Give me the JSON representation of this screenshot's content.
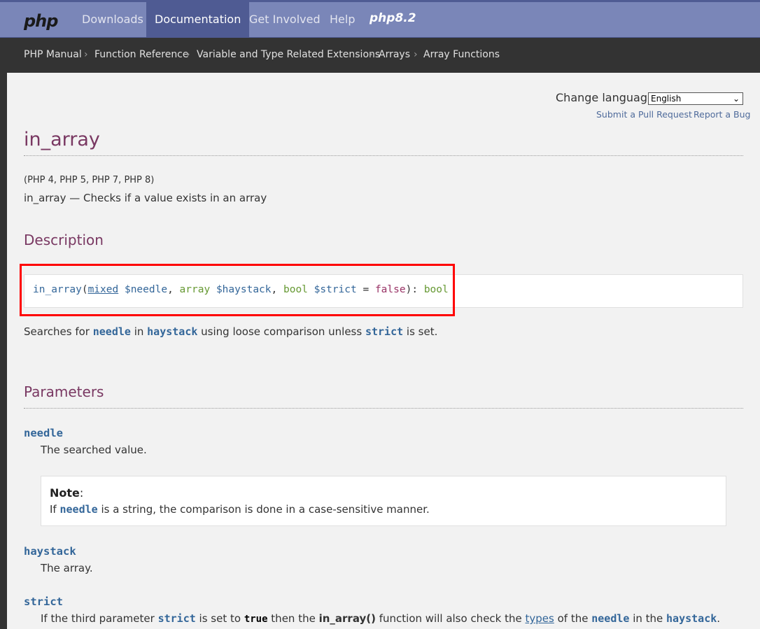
{
  "nav": {
    "logo": "php",
    "items": [
      "Downloads",
      "Documentation",
      "Get Involved",
      "Help"
    ],
    "release": "php8.2"
  },
  "breadcrumb": [
    "PHP Manual",
    "Function Reference",
    "Variable and Type Related Extensions",
    "Arrays",
    "Array Functions"
  ],
  "breadcrumb_sep": "›",
  "lang": {
    "label": "Change language:",
    "selected": "English",
    "submit_pr": "Submit a Pull Request",
    "report_bug": "Report a Bug"
  },
  "page": {
    "title": "in_array",
    "versions": "(PHP 4, PHP 5, PHP 7, PHP 8)",
    "refpurpose": "in_array — Checks if a value exists in an array"
  },
  "description": {
    "heading": "Description",
    "signature": {
      "fn": "in_array",
      "open": "(",
      "t1": "mixed",
      "v1": "$needle",
      "comma1": ", ",
      "t2": "array",
      "v2": "$haystack",
      "comma2": ", ",
      "t3": "bool",
      "v3": "$strict",
      "eq": " = ",
      "default": "false",
      "close": "): ",
      "ret": "bool"
    },
    "text": {
      "a": "Searches for ",
      "needle": "needle",
      "b": " in ",
      "haystack": "haystack",
      "c": " using loose comparison unless ",
      "strict": "strict",
      "d": " is set."
    }
  },
  "parameters": {
    "heading": "Parameters",
    "needle": {
      "name": "needle",
      "desc": "The searched value."
    },
    "note": {
      "title": "Note",
      "colon": ":",
      "a": "If ",
      "needle": "needle",
      "b": " is a string, the comparison is done in a case-sensitive manner."
    },
    "haystack": {
      "name": "haystack",
      "desc": "The array."
    },
    "strict": {
      "name": "strict",
      "a": "If the third parameter ",
      "strict": "strict",
      "b": " is set to ",
      "true": "true",
      "c": " then the ",
      "fn": "in_array()",
      "d": " function will also check the ",
      "types": "types",
      "e": " of the ",
      "needle": "needle",
      "f": " in the ",
      "haystack": "haystack",
      "g": "."
    }
  }
}
